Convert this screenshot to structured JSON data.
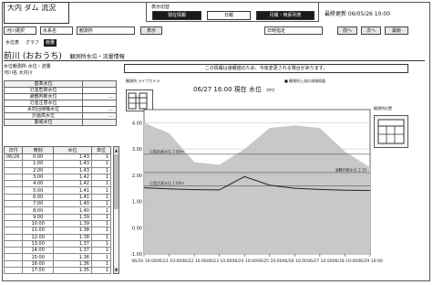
{
  "header": {
    "title": "大内 ダム 流況",
    "mode_group_label": "表示切替",
    "modes": [
      {
        "label": "現在情報",
        "active": true
      },
      {
        "label": "日報",
        "active": false
      },
      {
        "label": "月報・時系列表",
        "active": true
      }
    ],
    "update_time": "最終更新 06/05/26 10:00"
  },
  "toolbar": {
    "items": [
      {
        "type": "select",
        "label": "河川選択"
      },
      {
        "type": "select",
        "label": "水系名"
      },
      {
        "type": "select",
        "label": "観測所"
      },
      {
        "type": "button",
        "label": "表示"
      },
      {
        "type": "select",
        "label": "日時指定"
      },
      {
        "type": "button",
        "label": "前へ"
      },
      {
        "type": "button",
        "label": "次へ"
      },
      {
        "type": "button",
        "label": "最新"
      }
    ]
  },
  "tabs": [
    {
      "label": "水位表",
      "active": false
    },
    {
      "label": "グラフ",
      "active": false
    },
    {
      "label": "雨量",
      "active": true
    }
  ],
  "station": {
    "name": "前川 (おおうち)",
    "subtitle": "観測所水位・流量情報"
  },
  "info": {
    "head_line1": "水位観測所 水位・流量",
    "head_line2": "河川名 大内川",
    "rows": [
      {
        "label": "基準水位",
        "value": "",
        "header": true
      },
      {
        "label": "氾濫危険水位",
        "value": ""
      },
      {
        "label": "避難判断水位",
        "value": "...."
      },
      {
        "label": "氾濫注意水位",
        "value": ""
      },
      {
        "label": "水防団待機水位",
        "value": "...."
      },
      {
        "label": "計画高水位",
        "value": "...."
      },
      {
        "label": "警戒水位",
        "value": "",
        "header": true
      }
    ]
  },
  "table": {
    "headers": [
      "日付",
      "時刻",
      "水位",
      "単位"
    ],
    "rows": [
      {
        "date": "06/26",
        "time": "0:00",
        "level": "1.43",
        "mark": "1"
      },
      {
        "date": "",
        "time": "1:00",
        "level": "1.43",
        "mark": "1"
      },
      {
        "date": "",
        "time": "2:00",
        "level": "1.43",
        "mark": "1"
      },
      {
        "date": "",
        "time": "3:00",
        "level": "1.42",
        "mark": "1"
      },
      {
        "date": "",
        "time": "4:00",
        "level": "1.42",
        "mark": "1"
      },
      {
        "date": "",
        "time": "5:00",
        "level": "1.41",
        "mark": "1"
      },
      {
        "date": "",
        "time": "6:00",
        "level": "1.41",
        "mark": "1"
      },
      {
        "date": "",
        "time": "7:00",
        "level": "1.40",
        "mark": "1"
      },
      {
        "date": "",
        "time": "8:00",
        "level": "1.40",
        "mark": "1"
      },
      {
        "date": "",
        "time": "9:00",
        "level": "1.39",
        "mark": "1"
      },
      {
        "date": "",
        "time": "10:00",
        "level": "1.39",
        "mark": "1"
      },
      {
        "date": "",
        "time": "11:00",
        "level": "1.38",
        "mark": "1"
      },
      {
        "date": "",
        "time": "12:00",
        "level": "1.38",
        "mark": "1"
      },
      {
        "date": "",
        "time": "13:00",
        "level": "1.37",
        "mark": "1"
      },
      {
        "date": "",
        "time": "14:00",
        "level": "1.37",
        "mark": "1"
      },
      {
        "date": "",
        "time": "15:00",
        "level": "1.36",
        "mark": "1"
      },
      {
        "date": "",
        "time": "16:00",
        "level": "1.36",
        "mark": "1"
      },
      {
        "date": "",
        "time": "17:00",
        "level": "1.35",
        "mark": "1"
      }
    ]
  },
  "notice": "この情報は速報値のため、今後変更される場合があります。",
  "dam_label": "観測所 ライブカメラ",
  "graph": {
    "title": "06/27 16:00 現在 水位",
    "unit": "(m)",
    "note": "■ 観測所上流の流域雨量"
  },
  "right_panel": {
    "label": "観測所位置"
  },
  "chart_data": {
    "type": "area",
    "x": [
      "06/20 10:00",
      "06/21 10:00",
      "06/22 10:00",
      "06/23 10:00",
      "06/24 10:00",
      "06/25 10:00",
      "06/26 10:00",
      "06/27 10:00",
      "06/28 10:00",
      "06/29 10:00"
    ],
    "series": [
      {
        "name": "水位",
        "values": [
          1.52,
          1.48,
          1.45,
          1.44,
          1.95,
          1.62,
          1.5,
          1.46,
          1.43,
          1.42
        ]
      },
      {
        "name": "流域雨量",
        "values": [
          4.0,
          3.6,
          2.5,
          2.4,
          3.0,
          3.8,
          3.9,
          3.8,
          2.9,
          2.3
        ]
      }
    ],
    "yticks": [
      "4.00",
      "3.00",
      "2.00",
      "1.00",
      "0.00",
      "-1.00"
    ],
    "ylim": [
      -1.0,
      4.5
    ],
    "threshold_labels": [
      "氾濫危険水位 2.80m",
      "避難判断水位 2.10",
      "氾濫注意水位 1.60m"
    ],
    "thresholds": [
      2.8,
      2.1,
      1.6
    ],
    "grid": true,
    "colors": {
      "area": "#c8c8c8",
      "line": "#222222",
      "threshold": "#555555"
    }
  }
}
